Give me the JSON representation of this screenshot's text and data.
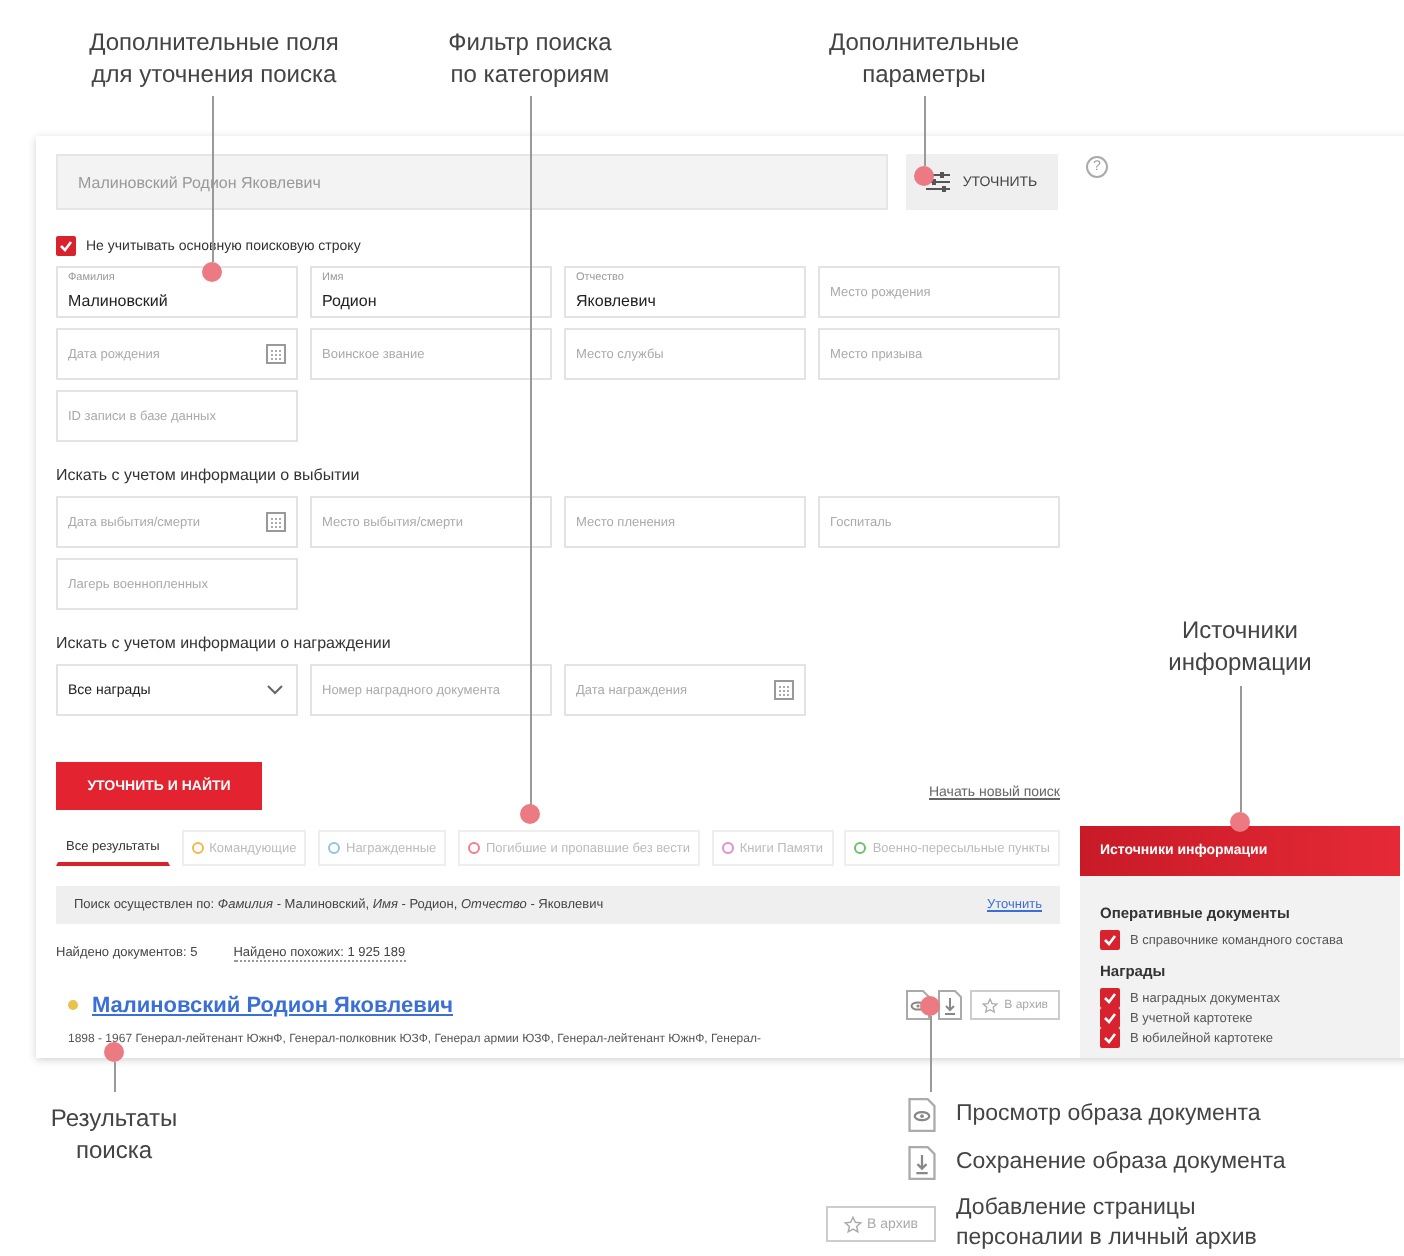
{
  "callouts": [
    {
      "text": "Дополнительные поля\nдля уточнения поиска"
    },
    {
      "text": "Фильтр поиска\nпо категориям"
    },
    {
      "text": "Дополнительные\nпараметры"
    },
    {
      "text": "Источники\nинформации"
    },
    {
      "text": "Результаты\nпоиска"
    }
  ],
  "search": {
    "placeholder": "Малиновский Родион Яковлевич"
  },
  "refine_button": "УТОЧНИТЬ",
  "help": "?",
  "ignore_main": {
    "label": "Не учитывать основную поисковую строку",
    "checked": true
  },
  "form_sections": [
    {
      "fields": [
        {
          "kind": "text",
          "label": "Фамилия",
          "value": "Малиновский"
        },
        {
          "kind": "text",
          "label": "Имя",
          "value": "Родион"
        },
        {
          "kind": "text",
          "label": "Отчество",
          "value": "Яковлевич"
        },
        {
          "kind": "text",
          "placeholder": "Место рождения"
        },
        {
          "kind": "date",
          "placeholder": "Дата рождения"
        },
        {
          "kind": "text",
          "placeholder": "Воинское звание"
        },
        {
          "kind": "text",
          "placeholder": "Место службы"
        },
        {
          "kind": "text",
          "placeholder": "Место призыва"
        },
        {
          "kind": "text",
          "placeholder": "ID записи в базе данных"
        }
      ]
    },
    {
      "heading": "Искать с учетом информации о выбытии",
      "fields": [
        {
          "kind": "date",
          "placeholder": "Дата выбытия/смерти"
        },
        {
          "kind": "text",
          "placeholder": "Место выбытия/смерти"
        },
        {
          "kind": "text",
          "placeholder": "Место пленения"
        },
        {
          "kind": "text",
          "placeholder": "Госпиталь"
        },
        {
          "kind": "text",
          "placeholder": "Лагерь военнопленных"
        }
      ]
    },
    {
      "heading": "Искать с учетом информации о награждении",
      "fields": [
        {
          "kind": "select",
          "value": "Все награды"
        },
        {
          "kind": "text",
          "placeholder": "Номер наградного документа"
        },
        {
          "kind": "date",
          "placeholder": "Дата награждения"
        }
      ]
    }
  ],
  "find_button": "УТОЧНИТЬ И НАЙТИ",
  "new_search_link": "Начать новый поиск",
  "tabs": [
    {
      "label": "Все результаты",
      "selected": true
    },
    {
      "label": "Командующие",
      "selected": false,
      "color": "#f0b94a"
    },
    {
      "label": "Награжденные",
      "selected": false,
      "color": "#8ec5ea"
    },
    {
      "label": "Погибшие и пропавшие без вести",
      "selected": false,
      "color": "#ef7f8f"
    },
    {
      "label": "Книги Памяти",
      "selected": false,
      "color": "#e58ad0"
    },
    {
      "label": "Военно-пересыльные пункты",
      "selected": false,
      "color": "#6cc06a"
    }
  ],
  "search_summary": {
    "text": "Поиск осуществлен по: *Фамилия* - Малиновский, *Имя* - Родион, *Отчество* - Яковлевич",
    "link": "Уточнить"
  },
  "found_count": "Найдено документов: 5",
  "similar_link": "Найдено похожих: 1 925 189",
  "results": [
    {
      "name": "Малиновский Родион Яковлевич",
      "color": "#e8c34a",
      "description": "1898 - 1967 Генерал-лейтенант ЮжнФ, Генерал-полковник ЮЗФ, Генерал армии ЮЗФ, Генерал-лейтенант ЮжнФ, Генерал-",
      "archive_button": "В архив"
    }
  ],
  "sources": {
    "title": "Источники информации",
    "groups": [
      {
        "heading": "Оперативные документы",
        "items": [
          {
            "label": "В справочнике командного состава",
            "checked": true
          }
        ]
      },
      {
        "heading": "Награды",
        "items": [
          {
            "label": "В наградных документах",
            "checked": true
          },
          {
            "label": "В учетной картотеке",
            "checked": true
          },
          {
            "label": "В юбилейной картотеке",
            "checked": true
          }
        ]
      }
    ]
  },
  "legend": [
    {
      "kind": "view",
      "text": "Просмотр образа документа"
    },
    {
      "kind": "download",
      "text": "Сохранение образа документа"
    },
    {
      "kind": "archive",
      "button": "В архив",
      "text": "Добавление страницы\nперсоналии в личный архив"
    }
  ]
}
